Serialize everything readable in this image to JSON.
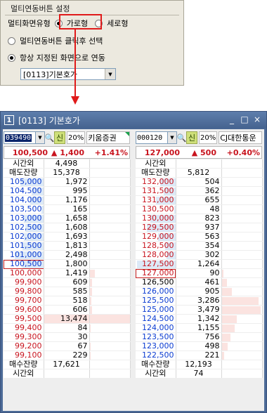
{
  "settings": {
    "title": "멀티연동버튼 설정",
    "layout_label": "멀티화면유형",
    "options": [
      {
        "label": "가로형",
        "selected": true
      },
      {
        "label": "세로형",
        "selected": false
      }
    ],
    "mode_click": "멀티연동버튼 클릭후 선택",
    "mode_always": "항상 지정된 화면으로 연동",
    "screen_select": "[0113]기본호가"
  },
  "window": {
    "number": "1",
    "title": "[0113] 기본호가",
    "controls": {
      "minimize": "_",
      "restore": "□",
      "close": "×"
    }
  },
  "colors": {
    "down": "#0a3bd1",
    "up": "#c8141e",
    "ask_bar": "#dce9f7",
    "bid_bar": "#fbe3e0"
  },
  "panels": [
    {
      "code": "039490",
      "sin": "신",
      "margin": "20%",
      "name": "키움증권",
      "price": "100,500",
      "change": "▲ 1,400",
      "rate": "+1.41%",
      "top_rows": [
        [
          "시간외",
          "4,498"
        ],
        [
          "매도잔량",
          "15,378"
        ]
      ],
      "asks": [
        {
          "price": "105,000",
          "qty": "1,972",
          "color": "down",
          "bar": 0.6
        },
        {
          "price": "104,500",
          "qty": "995",
          "color": "down",
          "bar": 0.3
        },
        {
          "price": "104,000",
          "qty": "1,176",
          "color": "down",
          "bar": 0.35
        },
        {
          "price": "103,500",
          "qty": "165",
          "color": "down",
          "bar": 0.05
        },
        {
          "price": "103,000",
          "qty": "1,658",
          "color": "down",
          "bar": 0.5
        },
        {
          "price": "102,500",
          "qty": "1,608",
          "color": "down",
          "bar": 0.48
        },
        {
          "price": "102,000",
          "qty": "1,693",
          "color": "down",
          "bar": 0.5
        },
        {
          "price": "101,500",
          "qty": "1,813",
          "color": "down",
          "bar": 0.55
        },
        {
          "price": "101,000",
          "qty": "2,498",
          "color": "down",
          "bar": 0.75
        },
        {
          "price": "100,500",
          "qty": "1,800",
          "color": "down",
          "bar": 0.54,
          "current": true
        }
      ],
      "bids": [
        {
          "price": "100,000",
          "qty": "1,419",
          "color": "up",
          "bar": 0.12
        },
        {
          "price": "99,900",
          "qty": "609",
          "color": "up",
          "bar": 0.05
        },
        {
          "price": "99,800",
          "qty": "585",
          "color": "up",
          "bar": 0.05
        },
        {
          "price": "99,700",
          "qty": "518",
          "color": "up",
          "bar": 0.04
        },
        {
          "price": "99,600",
          "qty": "606",
          "color": "up",
          "bar": 0.05
        },
        {
          "price": "99,500",
          "qty": "13,474",
          "color": "up",
          "bar": 1.0,
          "big": true
        },
        {
          "price": "99,400",
          "qty": "84",
          "color": "up",
          "bar": 0.01
        },
        {
          "price": "99,300",
          "qty": "30",
          "color": "up",
          "bar": 0.0
        },
        {
          "price": "99,200",
          "qty": "67",
          "color": "up",
          "bar": 0.01
        },
        {
          "price": "99,100",
          "qty": "229",
          "color": "up",
          "bar": 0.02
        }
      ],
      "bottom_rows": [
        [
          "매수잔량",
          "17,621"
        ],
        [
          "시간외",
          ""
        ]
      ]
    },
    {
      "code": "000120",
      "sin": "신",
      "margin": "20%",
      "name": "CJ대한통운",
      "price": "127,000",
      "change": "▲ 500",
      "rate": "+0.40%",
      "top_rows": [
        [
          "시간외",
          ""
        ],
        [
          "매도잔량",
          "5,812"
        ]
      ],
      "asks": [
        {
          "price": "132,000",
          "qty": "504",
          "color": "up",
          "bar": 0.4
        },
        {
          "price": "131,500",
          "qty": "362",
          "color": "up",
          "bar": 0.3
        },
        {
          "price": "131,000",
          "qty": "655",
          "color": "up",
          "bar": 0.5
        },
        {
          "price": "130,500",
          "qty": "48",
          "color": "up",
          "bar": 0.04
        },
        {
          "price": "130,000",
          "qty": "823",
          "color": "up",
          "bar": 0.65
        },
        {
          "price": "129,500",
          "qty": "937",
          "color": "up",
          "bar": 0.74
        },
        {
          "price": "129,000",
          "qty": "563",
          "color": "up",
          "bar": 0.45
        },
        {
          "price": "128,500",
          "qty": "354",
          "color": "up",
          "bar": 0.28
        },
        {
          "price": "128,000",
          "qty": "302",
          "color": "up",
          "bar": 0.24
        },
        {
          "price": "127,500",
          "qty": "1,264",
          "color": "up",
          "bar": 1.0
        }
      ],
      "bids": [
        {
          "price": "127,000",
          "qty": "90",
          "color": "up",
          "bar": 0.03,
          "current": true
        },
        {
          "price": "126,500",
          "qty": "461",
          "color": "black",
          "bar": 0.13
        },
        {
          "price": "126,000",
          "qty": "905",
          "color": "down",
          "bar": 0.26
        },
        {
          "price": "125,500",
          "qty": "3,286",
          "color": "down",
          "bar": 0.95
        },
        {
          "price": "125,000",
          "qty": "3,479",
          "color": "down",
          "bar": 1.0
        },
        {
          "price": "124,500",
          "qty": "1,342",
          "color": "down",
          "bar": 0.39
        },
        {
          "price": "124,000",
          "qty": "1,155",
          "color": "down",
          "bar": 0.33
        },
        {
          "price": "123,500",
          "qty": "756",
          "color": "down",
          "bar": 0.22
        },
        {
          "price": "123,000",
          "qty": "498",
          "color": "down",
          "bar": 0.14
        },
        {
          "price": "122,500",
          "qty": "221",
          "color": "down",
          "bar": 0.06
        }
      ],
      "bottom_rows": [
        [
          "매수잔량",
          "12,193"
        ],
        [
          "시간외",
          "74"
        ]
      ]
    }
  ]
}
